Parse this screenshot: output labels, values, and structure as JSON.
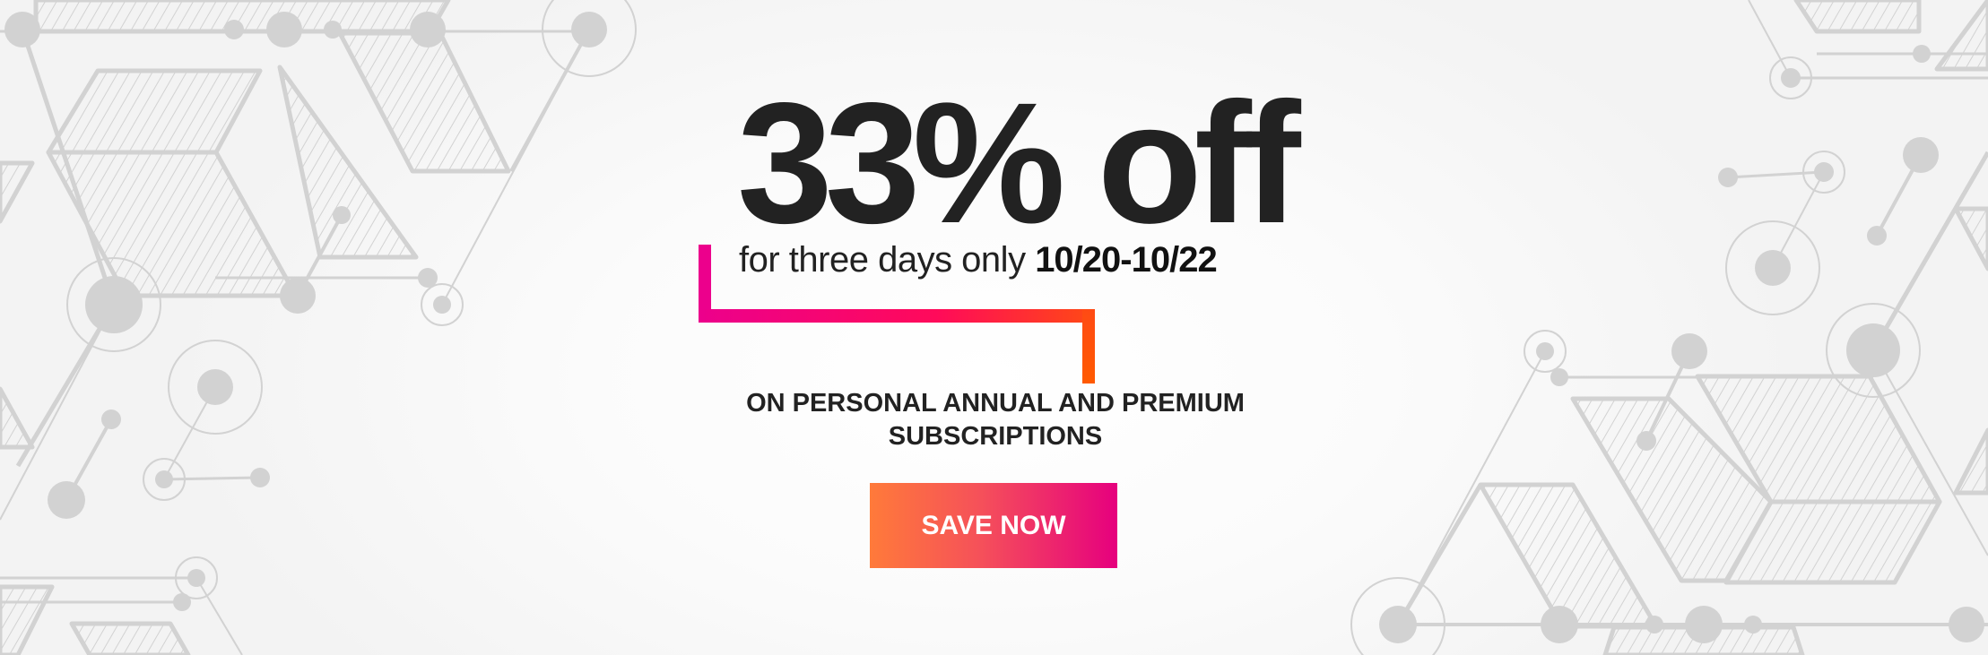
{
  "promo": {
    "headline": "33% off",
    "subline_prefix": "for three days only",
    "date_range": "10/20-10/22",
    "terms_line1": "ON PERSONAL ANNUAL AND PREMIUM",
    "terms_line2": "SUBSCRIPTIONS",
    "cta_label": "SAVE NOW"
  },
  "colors": {
    "accent_pink": "#ec008c",
    "accent_orange": "#ff5a00",
    "button_left": "#ff7a3a",
    "button_right": "#e6007e",
    "text": "#222222",
    "decor": "#d2d2d2"
  }
}
